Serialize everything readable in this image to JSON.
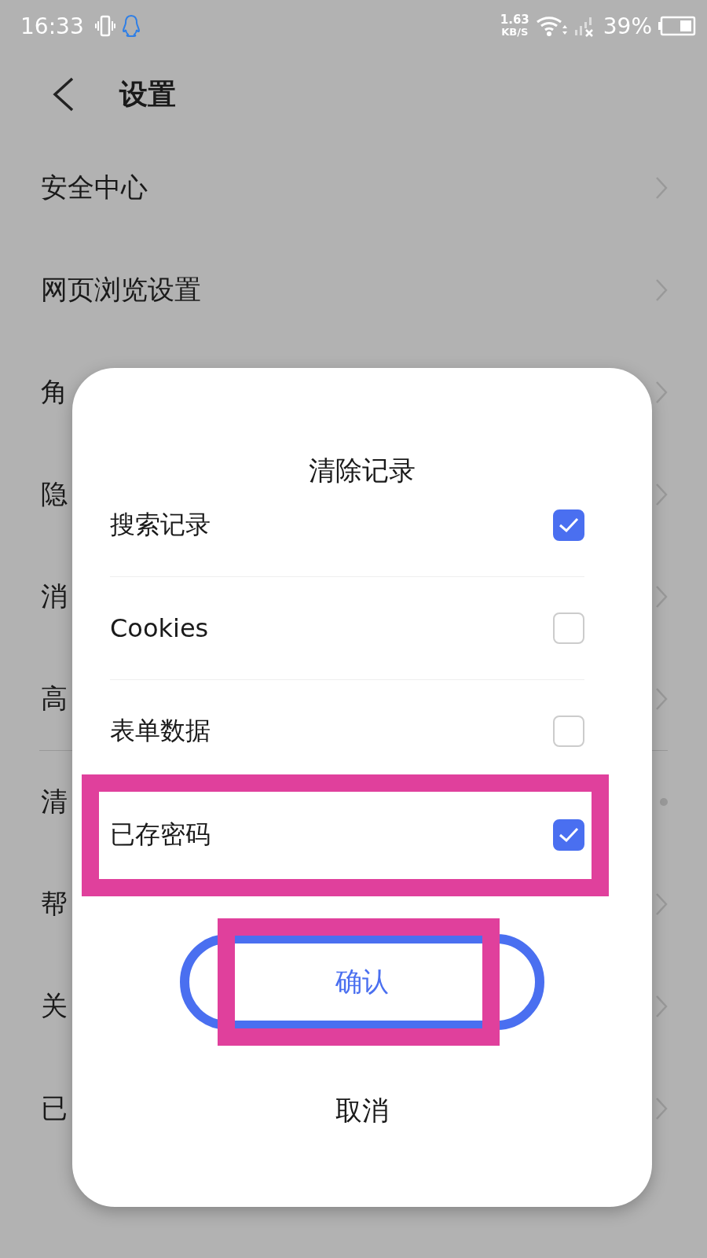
{
  "status_bar": {
    "time": "16:33",
    "net_speed": "1.63",
    "net_unit": "KB/S",
    "battery": "39%"
  },
  "header": {
    "title": "设置"
  },
  "settings_groups": [
    [
      {
        "label": "安全中心",
        "kind": "chevron"
      },
      {
        "label": "网页浏览设置",
        "kind": "chevron"
      },
      {
        "label": "角",
        "kind": "chevron"
      },
      {
        "label": "隐",
        "kind": "chevron"
      },
      {
        "label": "消",
        "kind": "chevron"
      },
      {
        "label": "高",
        "kind": "chevron"
      }
    ],
    [
      {
        "label": "清",
        "kind": "dot"
      },
      {
        "label": "帮",
        "kind": "chevron"
      },
      {
        "label": "关",
        "kind": "chevron"
      },
      {
        "label": "已",
        "kind": "chevron"
      }
    ]
  ],
  "dialog": {
    "title": "清除记录",
    "options": [
      {
        "label": "搜索记录",
        "checked": true,
        "highlighted": false
      },
      {
        "label": "Cookies",
        "checked": false,
        "highlighted": false
      },
      {
        "label": "表单数据",
        "checked": false,
        "highlighted": false
      },
      {
        "label": "已存密码",
        "checked": true,
        "highlighted": true
      }
    ],
    "confirm": {
      "label": "确认",
      "highlighted": true
    },
    "cancel": "取消"
  }
}
